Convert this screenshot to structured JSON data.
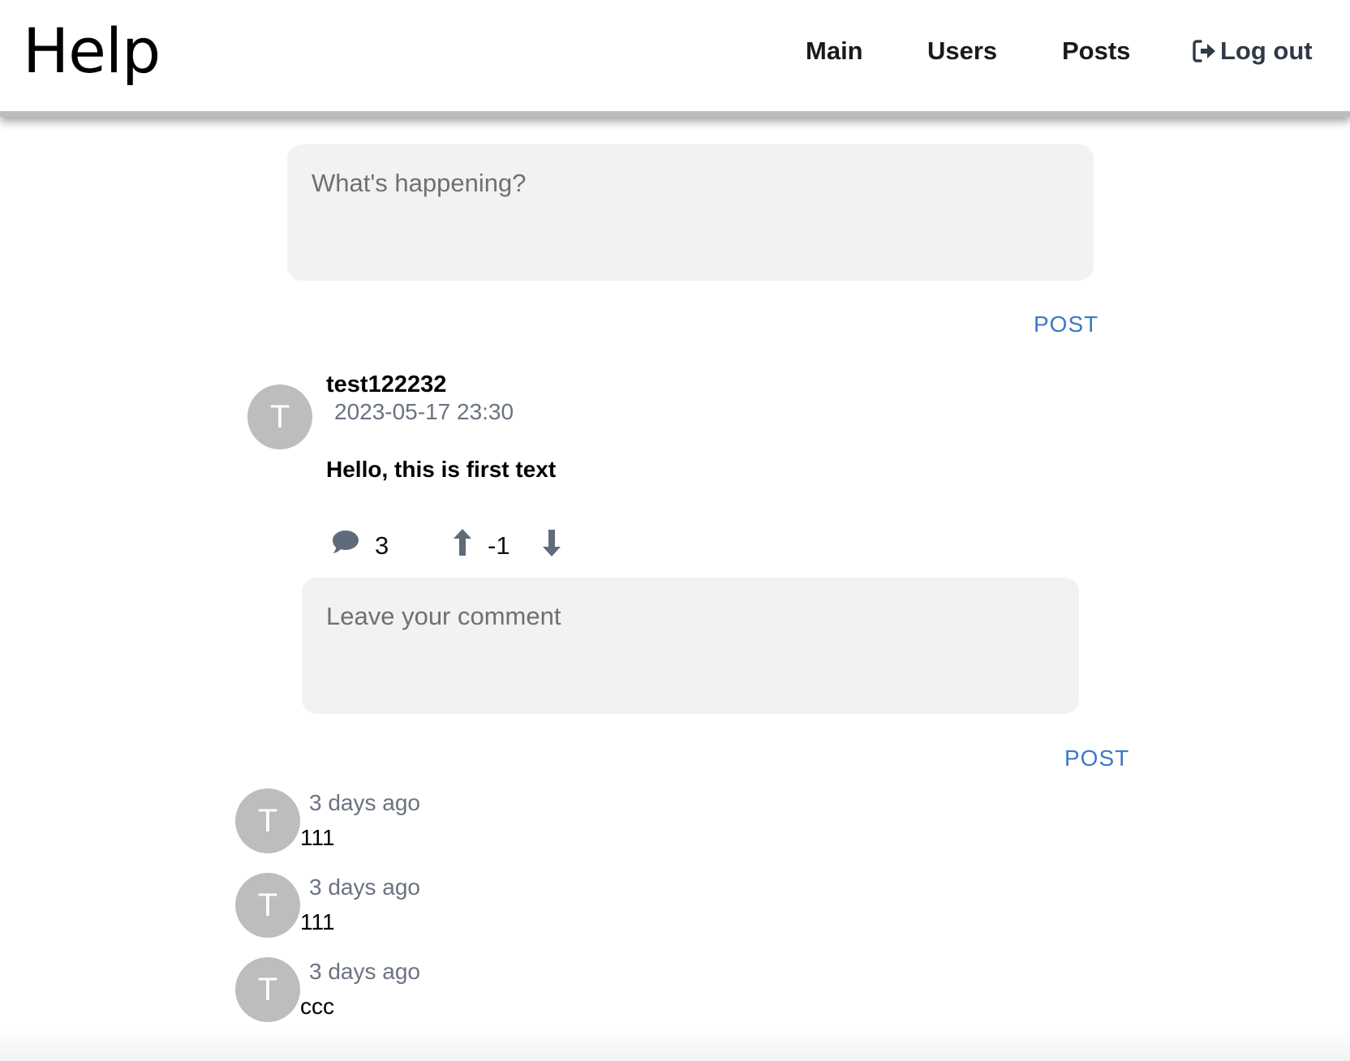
{
  "header": {
    "brand": "Help",
    "nav": {
      "main": "Main",
      "users": "Users",
      "posts": "Posts",
      "logout": "Log out"
    }
  },
  "composer": {
    "placeholder": "What's happening?",
    "post_label": "POST"
  },
  "post": {
    "avatar_initial": "T",
    "author": "test122232",
    "timestamp": "2023-05-17 23:30",
    "text": "Hello, this is first text",
    "comment_count": "3",
    "score": "-1",
    "comment_placeholder": "Leave your comment",
    "comment_post_label": "POST"
  },
  "comments": [
    {
      "avatar_initial": "T",
      "time": "3 days ago",
      "text": "111"
    },
    {
      "avatar_initial": "T",
      "time": "3 days ago",
      "text": "111"
    },
    {
      "avatar_initial": "T",
      "time": "3 days ago",
      "text": "ccc"
    }
  ],
  "colors": {
    "accent": "#3b79c8",
    "icon": "#5f6b7a",
    "avatar": "#bdbdbd",
    "input_bg": "#f2f2f2"
  },
  "icons": {
    "logout": "logout-icon",
    "comment": "comment-icon",
    "upvote": "arrow-up-icon",
    "downvote": "arrow-down-icon"
  }
}
